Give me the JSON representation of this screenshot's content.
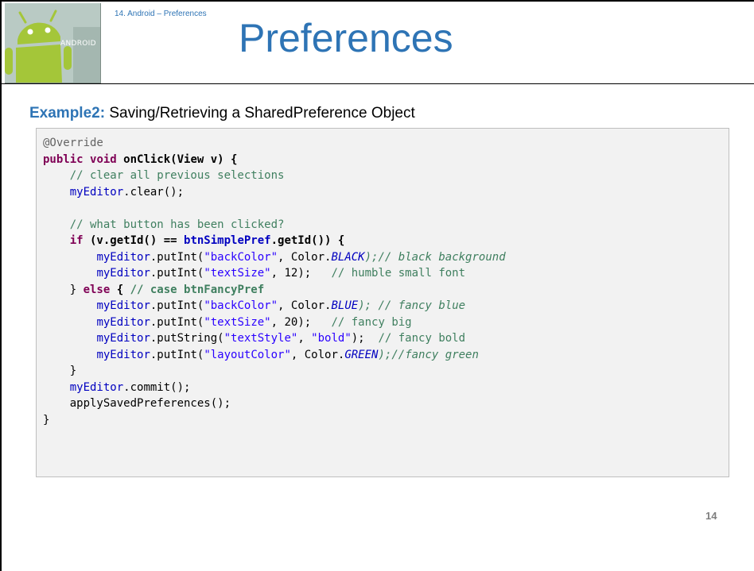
{
  "header": {
    "breadcrumb": "14. Android – Preferences",
    "title": "Preferences",
    "logo_text": "ANDROID"
  },
  "subtitle": {
    "label": "Example2:",
    "text": " Saving/Retrieving a SharedPreference Object"
  },
  "code": {
    "l1": "@Override",
    "l2_kw1": "public",
    "l2_kw2": "void",
    "l2_rest": " onClick(View v) {",
    "l3": "// clear all previous selections",
    "l4_fld": "myEditor",
    "l4_rest": ".clear();",
    "l6": "// what button has been clicked?",
    "l7_kw": "if",
    "l7_a": " (v.getId() == ",
    "l7_fld": "btnSimplePref",
    "l7_b": ".getId()) {",
    "l8_fld": "myEditor",
    "l8_a": ".putInt(",
    "l8_str": "\"backColor\"",
    "l8_b": ", Color.",
    "l8_const": "BLACK",
    "l8_c": ");",
    "l8_cm": "// black background",
    "l9_fld": "myEditor",
    "l9_a": ".putInt(",
    "l9_str": "\"textSize\"",
    "l9_b": ", 12);   ",
    "l9_cm": "// humble small font",
    "l10_a": "} ",
    "l10_kw": "else",
    "l10_b": " { ",
    "l10_cm": "// case btnFancyPref",
    "l11_fld": "myEditor",
    "l11_a": ".putInt(",
    "l11_str": "\"backColor\"",
    "l11_b": ", Color.",
    "l11_const": "BLUE",
    "l11_c": "); ",
    "l11_cm": "// fancy blue",
    "l12_fld": "myEditor",
    "l12_a": ".putInt(",
    "l12_str": "\"textSize\"",
    "l12_b": ", 20);   ",
    "l12_cm": "// fancy big",
    "l13_fld": "myEditor",
    "l13_a": ".putString(",
    "l13_str1": "\"textStyle\"",
    "l13_b": ", ",
    "l13_str2": "\"bold\"",
    "l13_c": ");  ",
    "l13_cm": "// fancy bold",
    "l14_fld": "myEditor",
    "l14_a": ".putInt(",
    "l14_str": "\"layoutColor\"",
    "l14_b": ", Color.",
    "l14_const": "GREEN",
    "l14_c": ");",
    "l14_cm": "//fancy green",
    "l15": "}",
    "l16_fld": "myEditor",
    "l16_rest": ".commit();",
    "l17": "applySavedPreferences();",
    "l18": "}"
  },
  "page_number": "14"
}
